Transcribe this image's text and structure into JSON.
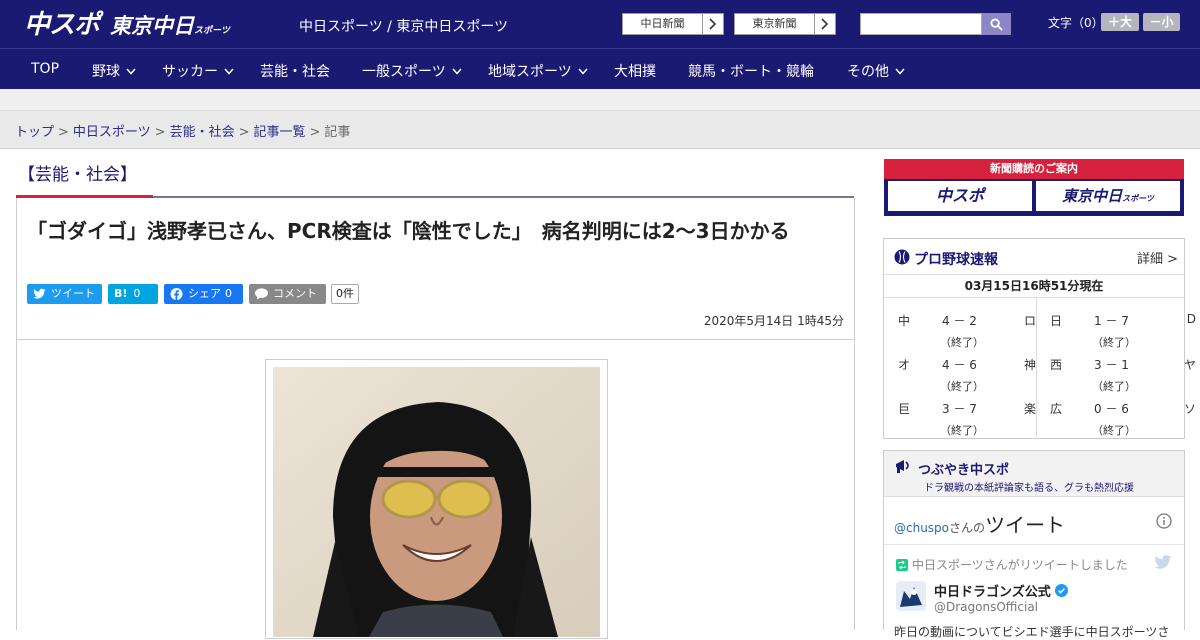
{
  "header": {
    "logo_chuspo": "中スポ",
    "logo_tokyo": "東京中日",
    "logo_tokyo_small": "スポーツ",
    "site_title": "中日スポーツ / 東京中日スポーツ",
    "paper_chunichi": "中日新聞",
    "paper_tokyo": "東京新聞",
    "search_placeholder": "",
    "font_size_label": "文字（0）",
    "font_large": "＋大",
    "font_small": "－小"
  },
  "nav": {
    "items": [
      {
        "label": "TOP",
        "has_dropdown": false
      },
      {
        "label": "野球",
        "has_dropdown": true
      },
      {
        "label": "サッカー",
        "has_dropdown": true
      },
      {
        "label": "芸能・社会",
        "has_dropdown": false
      },
      {
        "label": "一般スポーツ",
        "has_dropdown": true
      },
      {
        "label": "地域スポーツ",
        "has_dropdown": true
      },
      {
        "label": "大相撲",
        "has_dropdown": false
      },
      {
        "label": "競馬・ボート・競輪",
        "has_dropdown": false
      },
      {
        "label": "その他",
        "has_dropdown": true
      }
    ]
  },
  "breadcrumb": {
    "items": [
      "トップ",
      "中日スポーツ",
      "芸能・社会",
      "記事一覧"
    ],
    "current": "記事",
    "separator": ">"
  },
  "article": {
    "category": "【芸能・社会】",
    "headline": "「ゴダイゴ」浅野孝已さん、PCR検査は「陰性でした」　病名判明には2～3日かかる",
    "share": {
      "tweet": "ツイート",
      "hatena": "B!",
      "hatena_count": "0",
      "facebook": "シェア",
      "facebook_count": "0",
      "comment": "コメント",
      "comment_count": "0件"
    },
    "date": "2020年5月14日 1時45分"
  },
  "sidebar": {
    "ad": {
      "title": "新聞購読のご案内",
      "chuspo": "中スポ",
      "tokyo": "東京中日",
      "tokyo_small": "スポーツ"
    },
    "baseball": {
      "title": "プロ野球速報",
      "detail": "詳細 >",
      "timestamp": "03月15日16時51分現在",
      "games": [
        {
          "home": "中",
          "score": "4 － 2",
          "away": "ロ",
          "status": "（終了）"
        },
        {
          "home": "日",
          "score": "1 － 7",
          "away": "D",
          "status": "（終了）"
        },
        {
          "home": "オ",
          "score": "4 － 6",
          "away": "神",
          "status": "（終了）"
        },
        {
          "home": "西",
          "score": "3 － 1",
          "away": "ヤ",
          "status": "（終了）"
        },
        {
          "home": "巨",
          "score": "3 － 7",
          "away": "楽",
          "status": "（終了）"
        },
        {
          "home": "広",
          "score": "0 － 6",
          "away": "ソ",
          "status": "（終了）"
        }
      ]
    },
    "tweets": {
      "title": "つぶやき中スポ",
      "subtitle": "ドラ観戦の本紙評論家も語る、グラも熱烈応援",
      "account": "@chuspo",
      "by_suffix": "さんの",
      "tweet_word": "ツイート",
      "retweet_note": "中日スポーツさんがリツイートしました",
      "user_name": "中日ドラゴンズ公式",
      "user_handle": "@DragonsOfficial",
      "tweet_text": "昨日の動画についてビシエド選手に中日スポーツさ"
    }
  },
  "colors": {
    "brand_navy": "#1b1a73",
    "accent_red": "#d6213f",
    "twitter": "#1d9bf0",
    "hatena": "#00a4de",
    "facebook": "#1877f2"
  }
}
